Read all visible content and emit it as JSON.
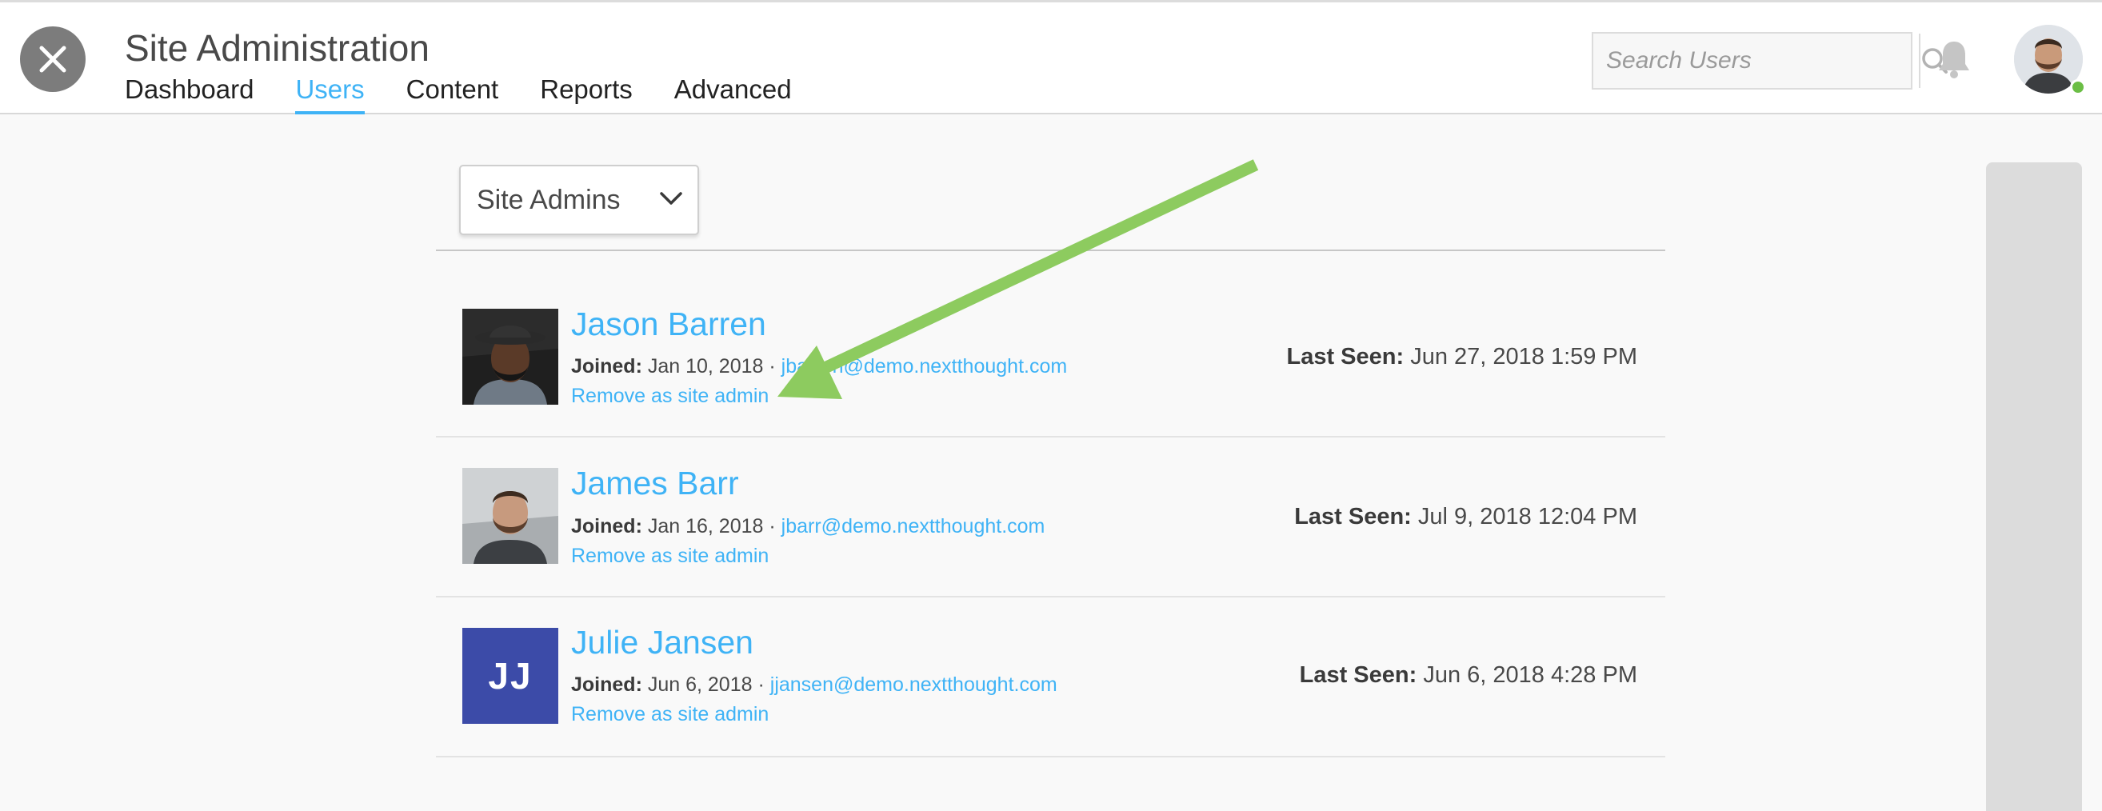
{
  "header": {
    "title": "Site Administration",
    "tabs": [
      {
        "label": "Dashboard",
        "active": false
      },
      {
        "label": "Users",
        "active": true
      },
      {
        "label": "Content",
        "active": false
      },
      {
        "label": "Reports",
        "active": false
      },
      {
        "label": "Advanced",
        "active": false
      }
    ],
    "search_placeholder": "Search Users",
    "icons": {
      "close": "close-icon",
      "search": "search-icon",
      "notifications": "bell-icon",
      "presence": "online-status"
    }
  },
  "filter": {
    "selected": "Site Admins",
    "icon": "chevron-down-icon"
  },
  "users": [
    {
      "name": "Jason Barren",
      "joined_label": "Joined:",
      "joined": "Jan 10, 2018",
      "separator": "·",
      "email": "jbarren@demo.nextthought.com",
      "action": "Remove as site admin",
      "last_seen_label": "Last Seen:",
      "last_seen": "Jun 27, 2018 1:59 PM"
    },
    {
      "name": "James Barr",
      "joined_label": "Joined:",
      "joined": "Jan 16, 2018",
      "separator": "·",
      "email": "jbarr@demo.nextthought.com",
      "action": "Remove as site admin",
      "last_seen_label": "Last Seen:",
      "last_seen": "Jul 9, 2018 12:04 PM"
    },
    {
      "name": "Julie Jansen",
      "initials": "JJ",
      "joined_label": "Joined:",
      "joined": "Jun 6, 2018",
      "separator": "·",
      "email": "jjansen@demo.nextthought.com",
      "action": "Remove as site admin",
      "last_seen_label": "Last Seen:",
      "last_seen": "Jun 6, 2018 4:28 PM"
    }
  ],
  "colors": {
    "accent": "#3fb3f6",
    "initials_bg": "#3c4ba8",
    "presence": "#6bbe45",
    "annotation_arrow": "#8dcb5f"
  }
}
